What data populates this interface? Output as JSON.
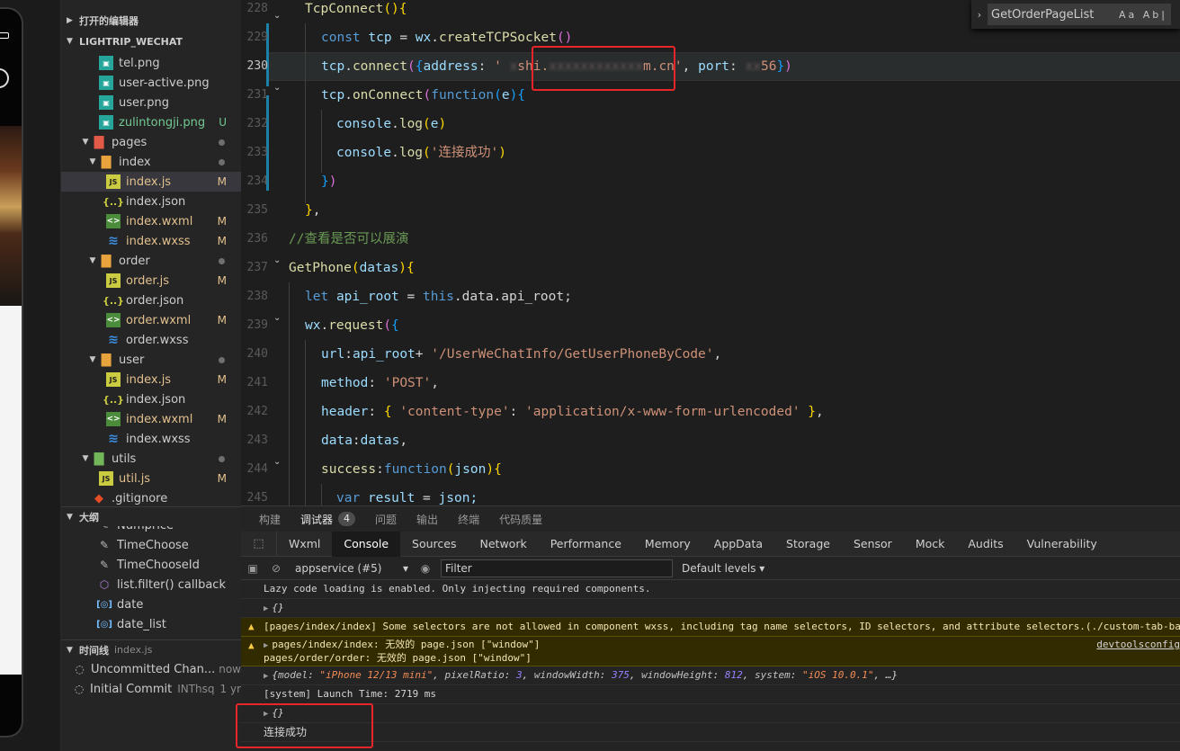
{
  "explorer": {
    "open_editors": "打开的编辑器",
    "project": "LIGHTRIP_WECHAT",
    "files": [
      {
        "name": "tel.png"
      },
      {
        "name": "user-active.png"
      },
      {
        "name": "user.png"
      },
      {
        "name": "zulintongji.png",
        "badge": "U"
      },
      {
        "name": "pages"
      },
      {
        "name": "index"
      },
      {
        "name": "index.js",
        "badge": "M"
      },
      {
        "name": "index.json"
      },
      {
        "name": "index.wxml",
        "badge": "M"
      },
      {
        "name": "index.wxss",
        "badge": "M"
      },
      {
        "name": "order"
      },
      {
        "name": "order.js",
        "badge": "M"
      },
      {
        "name": "order.json"
      },
      {
        "name": "order.wxml",
        "badge": "M"
      },
      {
        "name": "order.wxss"
      },
      {
        "name": "user"
      },
      {
        "name": "index.js",
        "badge": "M"
      },
      {
        "name": "index.json"
      },
      {
        "name": "index.wxml",
        "badge": "M"
      },
      {
        "name": "index.wxss"
      },
      {
        "name": "utils"
      },
      {
        "name": "util.js",
        "badge": "M"
      },
      {
        "name": ".gitignore"
      }
    ],
    "json_icon": "{..}",
    "js_icon": "JS",
    "outline_title": "大纲",
    "outline": [
      "Numprice",
      "TimeChoose",
      "TimeChooseId",
      "list.filter() callback",
      "date",
      "date_list"
    ],
    "timeline_title": "时间线",
    "timeline_file": "index.js",
    "timeline": [
      {
        "label": "Uncommitted Chan...",
        "time": "now"
      },
      {
        "label": "Initial Commit",
        "author": "INThsq",
        "time": "1 yr"
      }
    ]
  },
  "editor": {
    "line_numbers": [
      "228",
      "229",
      "230",
      "231",
      "232",
      "233",
      "234",
      "235",
      "236",
      "237",
      "238",
      "239",
      "240",
      "241",
      "242",
      "243",
      "244",
      "245"
    ],
    "find_query": "GetOrderPageList",
    "find_options": "Aa Ab|",
    "code": {
      "l228_fn": "TcpConnect",
      "l229_const": "const",
      "l229_var": "tcp",
      "l229_eq": " = ",
      "l229_wx": "wx",
      "l229_fn": "createTCPSocket",
      "l230_obj": "tcp",
      "l230_fn": "connect",
      "l230_key": "address",
      "l230_str_a": "'",
      "l230_str_b": "shi.",
      "l230_str_c": "xxxxxxxxxxxx",
      "l230_str_d": "m.cn'",
      "l230_port": "port",
      "l230_num": "56",
      "l231_obj": "tcp",
      "l231_fn": "onConnect",
      "l231_kw": "function",
      "l231_param": "e",
      "l232_obj": "console",
      "l232_fn": "log",
      "l232_arg": "e",
      "l233_obj": "console",
      "l233_fn": "log",
      "l233_str": "'连接成功'",
      "l236_comment": "//查看是否可以展演",
      "l237_fn": "GetPhone",
      "l237_param": "datas",
      "l238_let": "let",
      "l238_var": "api_root",
      "l238_this": "this",
      "l238_rest": ".data.api_root;",
      "l239_wx": "wx",
      "l239_fn": "request",
      "l240_key": "url",
      "l240_var": "api_root",
      "l240_str": "'/UserWeChatInfo/GetUserPhoneByCode'",
      "l241_key": "method",
      "l241_str": "'POST'",
      "l242_key": "header",
      "l242_k": "'content-type'",
      "l242_v": "'application/x-www-form-urlencoded'",
      "l243_key": "data",
      "l243_var": "datas",
      "l244_key": "success",
      "l244_kw": "function",
      "l244_param": "json",
      "l245_var": "var",
      "l245_name": "result",
      "l245_val": "json;"
    }
  },
  "panel": {
    "tabs": [
      {
        "label": "构建"
      },
      {
        "label": "调试器",
        "count": "4"
      },
      {
        "label": "问题"
      },
      {
        "label": "输出"
      },
      {
        "label": "终端"
      },
      {
        "label": "代码质量"
      }
    ],
    "devtools_tabs": [
      "Wxml",
      "Console",
      "Sources",
      "Network",
      "Performance",
      "Memory",
      "AppData",
      "Storage",
      "Sensor",
      "Mock",
      "Audits",
      "Vulnerability"
    ],
    "context": "appservice (#5)",
    "filter_placeholder": "Filter",
    "levels": "Default levels",
    "console": {
      "lazy": "Lazy code loading is enabled. Only injecting required components.",
      "obj": "{}",
      "warn1": "[pages/index/index] Some selectors are not allowed in component wxss, including tag name selectors, ID selectors, and attribute selectors.(./custom-tab-bar",
      "warn2a": "pages/index/index: 无效的 page.json [\"window\"]",
      "warn2b": "pages/order/order: 无效的 page.json [\"window\"]",
      "warn2_src": "devtoolsconfig",
      "sys_model_k": "model",
      "sys_model_v": "\"iPhone 12/13 mini\"",
      "sys_ratio_k": "pixelRatio",
      "sys_ratio_v": "3",
      "sys_w_k": "windowWidth",
      "sys_w_v": "375",
      "sys_h_k": "windowHeight",
      "sys_h_v": "812",
      "sys_os_k": "system",
      "sys_os_v": "\"iOS 10.0.1\"",
      "sys_tail": ", …}",
      "launch": "[system] Launch Time: 2719 ms",
      "obj2": "{}",
      "success": "连接成功"
    }
  }
}
